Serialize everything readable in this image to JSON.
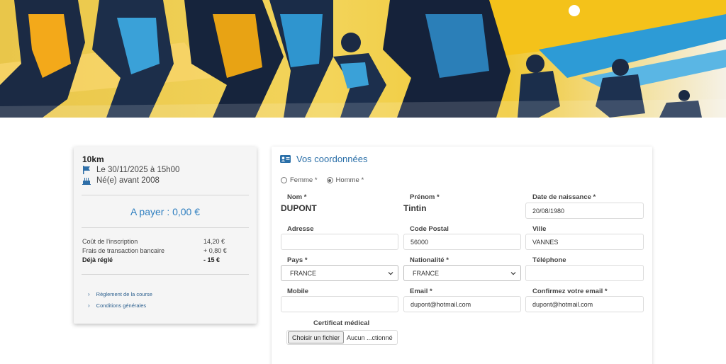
{
  "banner": {
    "description_icon": "runners-banner-image"
  },
  "summary": {
    "race_name": "10km",
    "date_line": "Le 30/11/2025 à 15h00",
    "birth_line": "Né(e) avant 2008",
    "pay_label": "A payer : 0,00 €",
    "fees": [
      {
        "label": "Coût de l'inscription",
        "value": "14,20 €",
        "bold": false
      },
      {
        "label": "Frais de transaction bancaire",
        "value": "+ 0,80 €",
        "bold": false
      },
      {
        "label": "Déjà réglé",
        "value": "- 15 €",
        "bold": true
      }
    ],
    "links": [
      "Règlement de la course",
      "Conditions générales"
    ],
    "icons": {
      "date": "flag-icon",
      "birth": "cake-icon",
      "link": "chevron-right-icon"
    }
  },
  "form": {
    "title": "Vos coordonnées",
    "title_icon": "id-card-icon",
    "gender": {
      "options": [
        "Femme *",
        "Homme *"
      ],
      "selected": "Homme *"
    },
    "nom": {
      "label": "Nom *",
      "value": "DUPONT"
    },
    "prenom": {
      "label": "Prénom *",
      "value": "Tintin"
    },
    "naissance": {
      "label": "Date de naissance *",
      "value": "20/08/1980"
    },
    "adresse": {
      "label": "Adresse",
      "value": ""
    },
    "code_postal": {
      "label": "Code Postal",
      "value": "56000"
    },
    "ville": {
      "label": "Ville",
      "value": "VANNES"
    },
    "pays": {
      "label": "Pays *",
      "value": "FRANCE"
    },
    "nationalite": {
      "label": "Nationalité *",
      "value": "FRANCE"
    },
    "telephone": {
      "label": "Téléphone",
      "value": ""
    },
    "mobile": {
      "label": "Mobile",
      "value": ""
    },
    "email": {
      "label": "Email *",
      "value": "dupont@hotmail.com"
    },
    "email_confirm": {
      "label": "Confirmez votre email *",
      "value": "dupont@hotmail.com"
    },
    "certificat": {
      "label": "Certificat médical",
      "button": "Choisir un fichier",
      "status": "Aucun ...ctionné"
    }
  },
  "colors": {
    "accent": "#2f7fc0",
    "link": "#2b5f8e",
    "card_bg": "#f5f5f5"
  }
}
